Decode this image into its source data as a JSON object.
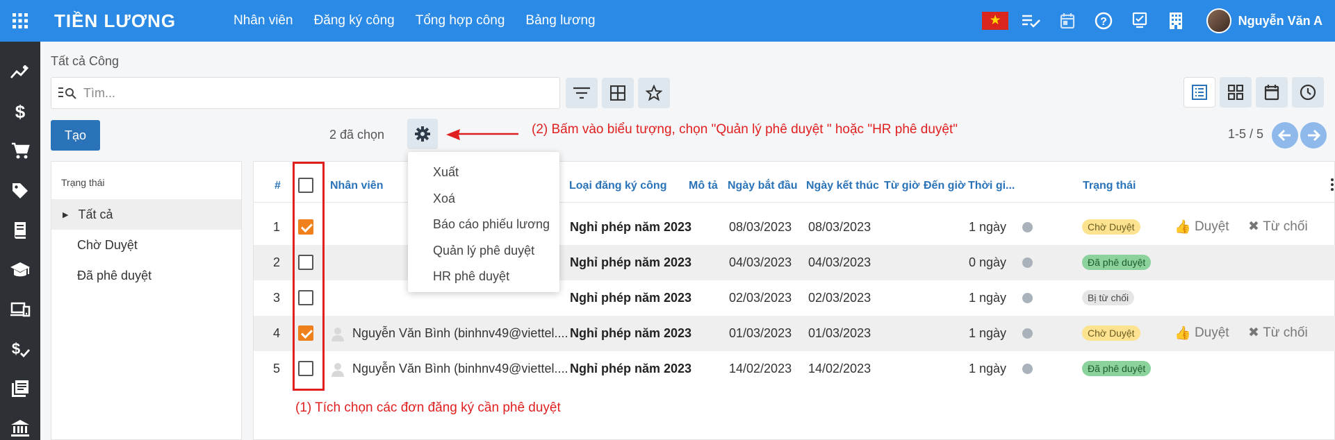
{
  "app": {
    "title": "TIỀN LƯƠNG"
  },
  "nav": [
    "Nhân viên",
    "Đăng ký công",
    "Tổng hợp công",
    "Bảng lương"
  ],
  "user": {
    "name": "Nguyễn Văn A"
  },
  "breadcrumb": "Tất cả Công",
  "search": {
    "placeholder": "Tìm..."
  },
  "toolbar": {
    "create_label": "Tạo",
    "selected_count": "2 đã chọn",
    "pager": "1-5 / 5"
  },
  "annotations": {
    "step1": "(1) Tích chọn các đơn đăng ký cần phê duyệt",
    "step2": "(2) Bấm vào biểu tượng, chọn \"Quản lý phê duyệt \" hoặc \"HR phê duyệt\""
  },
  "sidebar": {
    "title": "Trạng thái",
    "items": [
      "Tất cả",
      "Chờ Duyệt",
      "Đã phê duyệt"
    ]
  },
  "dropdown": {
    "items": [
      "Xuất",
      "Xoá",
      "Báo cáo phiếu lương",
      "Quản lý phê duyệt",
      "HR phê duyệt"
    ]
  },
  "table": {
    "columns": {
      "num": "#",
      "employee": "Nhân viên",
      "type": "Loại đăng ký công",
      "desc": "Mô tả",
      "start": "Ngày bắt đầu",
      "end": "Ngày kết thúc",
      "from_time": "Từ giờ",
      "to_time": "Đến giờ",
      "duration": "Thời gi...",
      "status": "Trạng thái"
    },
    "actions": {
      "approve": "Duyệt",
      "reject": "Từ chối"
    },
    "rows": [
      {
        "num": "1",
        "employee": "",
        "type": "Nghỉ phép năm 2023",
        "start": "08/03/2023",
        "end": "08/03/2023",
        "duration": "1 ngày",
        "status": "Chờ Duyệt",
        "status_kind": "wait",
        "checked": true
      },
      {
        "num": "2",
        "employee": "",
        "type": "Nghỉ phép năm 2023",
        "start": "04/03/2023",
        "end": "04/03/2023",
        "duration": "0 ngày",
        "status": "Đã phê duyệt",
        "status_kind": "ok",
        "checked": false
      },
      {
        "num": "3",
        "employee": "",
        "type": "Nghỉ phép năm 2023",
        "start": "02/03/2023",
        "end": "02/03/2023",
        "duration": "1 ngày",
        "status": "Bị từ chối",
        "status_kind": "rej",
        "checked": false
      },
      {
        "num": "4",
        "employee": "Nguyễn Văn Bình (binhnv49@viettel....",
        "type": "Nghỉ phép năm 2023",
        "start": "01/03/2023",
        "end": "01/03/2023",
        "duration": "1 ngày",
        "status": "Chờ Duyệt",
        "status_kind": "wait",
        "checked": true
      },
      {
        "num": "5",
        "employee": "Nguyễn Văn Bình (binhnv49@viettel....",
        "type": "Nghỉ phép năm 2023",
        "start": "14/02/2023",
        "end": "14/02/2023",
        "duration": "1 ngày",
        "status": "Đã phê duyệt",
        "status_kind": "ok",
        "checked": false
      }
    ]
  },
  "colors": {
    "primary": "#2a8ae6",
    "sidebar_dark": "#2d3135",
    "annotation": "#e02020",
    "checkbox_checked": "#f0801c"
  }
}
